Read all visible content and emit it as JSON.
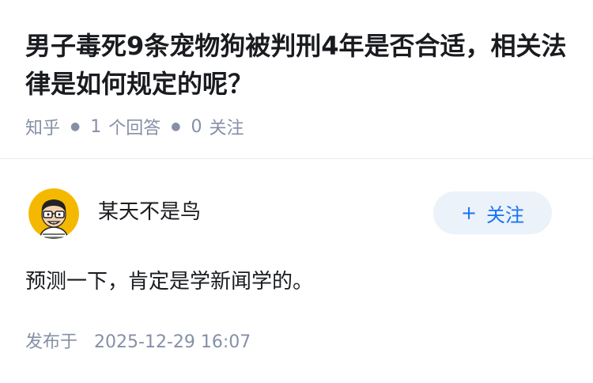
{
  "question": {
    "title": "男子毒死9条宠物狗被判刑4年是否合适，相关法律是如何规定的呢？",
    "meta": {
      "site": "知乎",
      "answers_count": "1",
      "answers_label": "个回答",
      "followers_count": "0",
      "followers_label": "关注"
    }
  },
  "answer": {
    "author": {
      "name": "某天不是鸟",
      "avatar_icon": "cartoon-avatar-glasses"
    },
    "follow_button": {
      "plus": "+",
      "label": "关注"
    },
    "content": "预测一下，肯定是学新闻学的。",
    "published": {
      "label": "发布于",
      "time": "2025-12-29 16:07"
    }
  },
  "colors": {
    "title_text": "#191b1f",
    "meta_text": "#8590a6",
    "accent": "#1772f6",
    "follow_button_bg": "#ebf2f9",
    "avatar_bg": "#f5b800"
  }
}
